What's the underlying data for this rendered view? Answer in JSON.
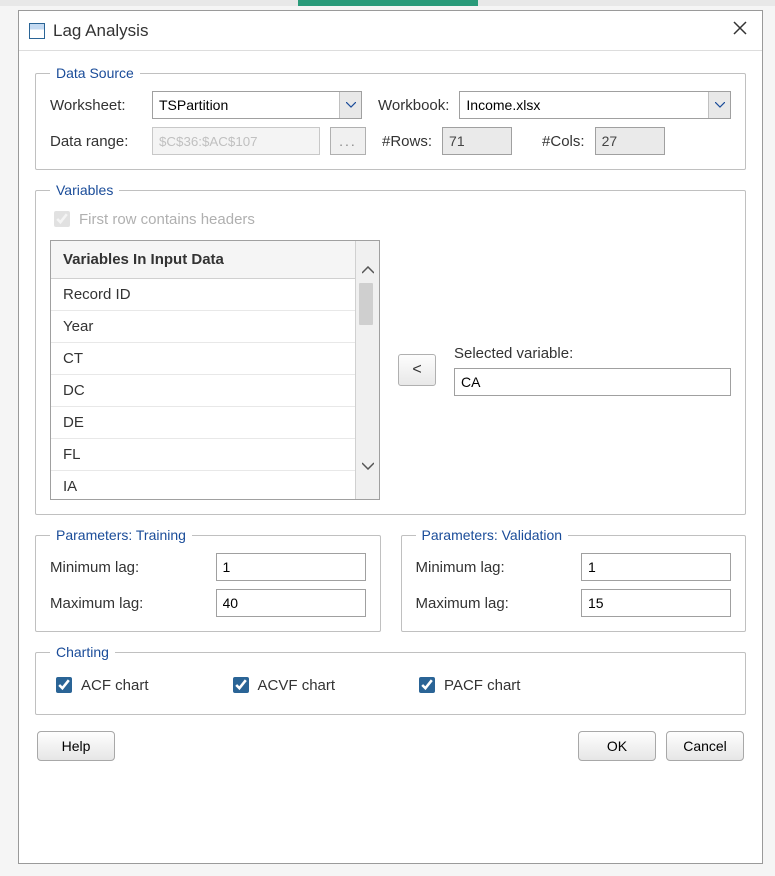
{
  "window": {
    "title": "Lag Analysis"
  },
  "data_source": {
    "legend": "Data Source",
    "worksheet_label": "Worksheet:",
    "worksheet_value": "TSPartition",
    "workbook_label": "Workbook:",
    "workbook_value": "Income.xlsx",
    "data_range_label": "Data range:",
    "data_range_value": "$C$36:$AC$107",
    "browse_label": "...",
    "rows_label": "#Rows:",
    "rows_value": "71",
    "cols_label": "#Cols:",
    "cols_value": "27"
  },
  "variables": {
    "legend": "Variables",
    "headers_checkbox_label": "First row contains headers",
    "list_header": "Variables In Input Data",
    "items": [
      "Record ID",
      "Year",
      "CT",
      "DC",
      "DE",
      "FL",
      "IA"
    ],
    "move_label": "<",
    "selected_label": "Selected variable:",
    "selected_value": "CA"
  },
  "params_training": {
    "legend": "Parameters: Training",
    "min_label": "Minimum lag:",
    "min_value": "1",
    "max_label": "Maximum lag:",
    "max_value": "40"
  },
  "params_validation": {
    "legend": "Parameters: Validation",
    "min_label": "Minimum lag:",
    "min_value": "1",
    "max_label": "Maximum lag:",
    "max_value": "15"
  },
  "charting": {
    "legend": "Charting",
    "acf_label": "ACF chart",
    "acvf_label": "ACVF chart",
    "pacf_label": "PACF chart"
  },
  "footer": {
    "help": "Help",
    "ok": "OK",
    "cancel": "Cancel"
  }
}
